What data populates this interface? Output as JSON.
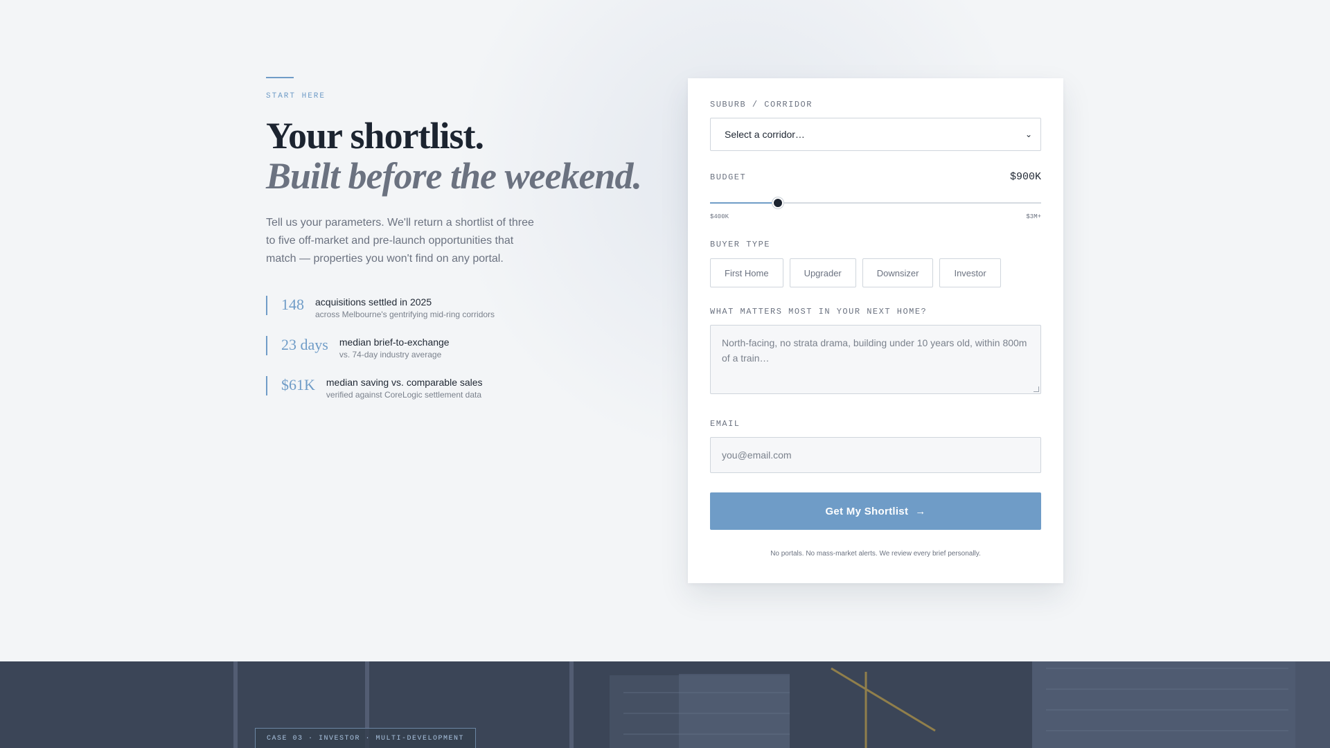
{
  "intro": {
    "eyebrow": "START HERE",
    "headline_line1": "Your shortlist.",
    "headline_line2": "Built before the weekend.",
    "lede": "Tell us your parameters. We'll return a shortlist of three to five off-market and pre-launch opportunities that match — properties you won't find on any portal.",
    "stats": [
      {
        "value": "148",
        "title": "acquisitions settled in 2025",
        "subtitle": "across Melbourne's gentrifying mid-ring corridors"
      },
      {
        "value": "23 days",
        "title": "median brief-to-exchange",
        "subtitle": "vs. 74-day industry average"
      },
      {
        "value": "$61K",
        "title": "median saving vs. comparable sales",
        "subtitle": "verified against CoreLogic settlement data"
      }
    ]
  },
  "form": {
    "suburb_label": "SUBURB / CORRIDOR",
    "suburb_value": "Select a corridor…",
    "budget_label": "BUDGET",
    "budget_value": "$900K",
    "budget_min": "$400K",
    "budget_max": "$3M+",
    "budget_fraction": 0.205,
    "buyer_type_label": "BUYER TYPE",
    "buyer_types": [
      "First Home",
      "Upgrader",
      "Downsizer",
      "Investor"
    ],
    "matters_label": "WHAT MATTERS MOST IN YOUR NEXT HOME?",
    "matters_placeholder": "North-facing, no strata drama, building under 10 years old, within 800m of a train…",
    "email_label": "EMAIL",
    "email_placeholder": "you@email.com",
    "submit_label": "Get My Shortlist",
    "fineprint": "No portals. No mass-market alerts. We review every brief personally."
  },
  "case_study": {
    "tag": "CASE 03 · INVESTOR · MULTI-DEVELOPMENT"
  },
  "colors": {
    "accent": "#6f9cc7",
    "ink": "#1c2430",
    "muted": "#6b7280",
    "band": "#3f4a5b"
  }
}
